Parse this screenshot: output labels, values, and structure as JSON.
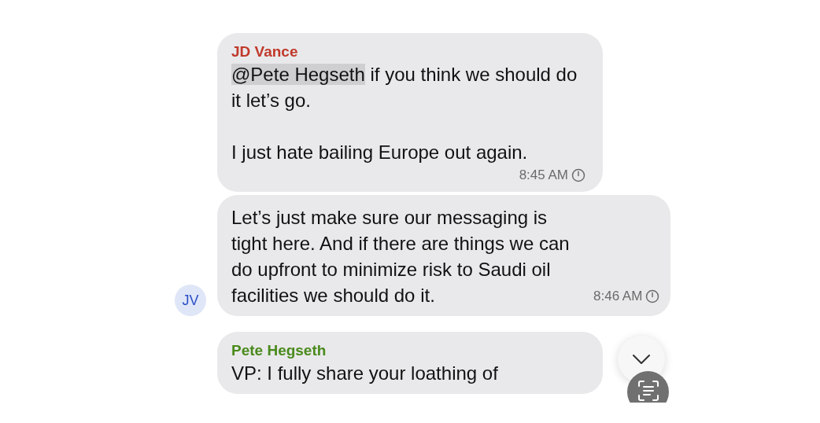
{
  "messages": [
    {
      "kind": "time-below",
      "sender": {
        "name": "JD Vance",
        "color": "#c0392b"
      },
      "mention": "@Pete Hegseth",
      "paragraphs": [
        " if you think we should do it let’s go.",
        "I just hate bailing Europe out again."
      ],
      "time": "8:45 AM"
    },
    {
      "kind": "time-inline",
      "paragraphs": [
        "Let’s just make sure our messaging is tight here. And if there are things we can do upfront to minimize risk to Saudi oil facilities we should do it."
      ],
      "time": "8:46 AM",
      "avatar": "JV"
    },
    {
      "kind": "time-below",
      "sender": {
        "name": "Pete Hegseth",
        "color": "#4a8a1c"
      },
      "paragraphs": [
        "VP: I fully share your loathing of"
      ]
    }
  ]
}
